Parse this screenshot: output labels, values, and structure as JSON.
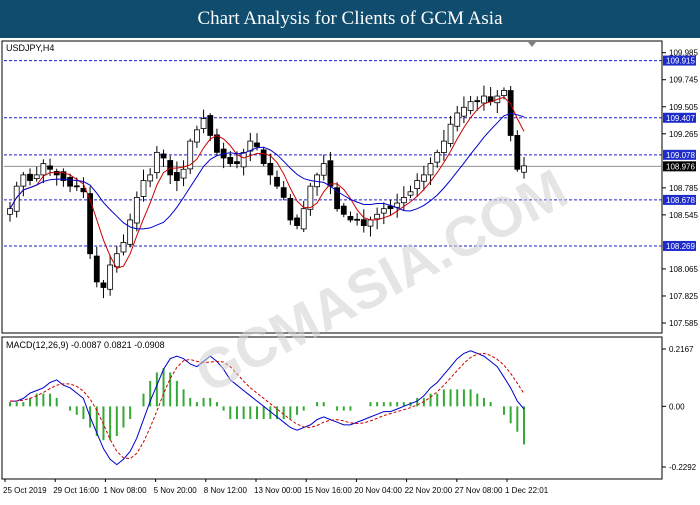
{
  "banner": {
    "title": "Chart Analysis for Clients of GCM Asia"
  },
  "watermark": "GCMASIA.COM",
  "chart_data": [
    {
      "type": "candlestick",
      "title": "USDJPY,H4",
      "ylim": [
        107.585,
        110.0
      ],
      "y_ticks": [
        "109.985",
        "109.745",
        "109.505",
        "109.265",
        "108.785",
        "108.545",
        "108.065",
        "107.825",
        "107.585"
      ],
      "levels": [
        {
          "label": "109.915",
          "value": 109.915
        },
        {
          "label": "109.407",
          "value": 109.407
        },
        {
          "label": "109.078",
          "value": 109.078
        },
        {
          "label": "108.678",
          "value": 108.678
        },
        {
          "label": "108.269",
          "value": 108.269
        }
      ],
      "current_price": {
        "label": "108.976",
        "value": 108.976
      },
      "close_path": [
        108.6,
        108.8,
        108.9,
        108.85,
        108.9,
        109.0,
        108.95,
        108.9,
        108.85,
        108.8,
        108.8,
        108.75,
        108.2,
        107.95,
        107.9,
        108.1,
        108.2,
        108.3,
        108.5,
        108.7,
        108.85,
        108.9,
        109.1,
        109.05,
        108.9,
        108.85,
        108.95,
        109.2,
        109.3,
        109.4,
        109.25,
        109.1,
        109.05,
        109.0,
        109.0,
        109.1,
        109.2,
        109.15,
        109.0,
        108.9,
        108.8,
        108.7,
        108.5,
        108.45,
        108.6,
        108.8,
        108.9,
        109.0,
        108.8,
        108.6,
        108.55,
        108.5,
        108.5,
        108.45,
        108.5,
        108.55,
        108.6,
        108.6,
        108.65,
        108.7,
        108.75,
        108.85,
        108.9,
        109.0,
        109.1,
        109.2,
        109.35,
        109.45,
        109.5,
        109.55,
        109.55,
        109.6,
        109.55,
        109.6,
        109.65,
        109.25,
        108.95,
        108.98
      ],
      "x_labels": [
        "25 Oct 2019",
        "29 Oct 16:00",
        "1 Nov 08:00",
        "5 Nov 20:00",
        "8 Nov 12:00",
        "13 Nov 00:00",
        "15 Nov 16:00",
        "20 Nov 04:00",
        "22 Nov 20:00",
        "27 Nov 08:00",
        "1 Dec 22:01"
      ],
      "series": [
        {
          "color": "#cc0000"
        },
        {
          "color": "#0000cc"
        }
      ]
    },
    {
      "type": "macd",
      "title": "MACD(12,26,9) -0.0087 0.0821 -0.0908",
      "ylim": [
        -0.2292,
        0.2167
      ],
      "y_ticks": [
        "0.2167",
        "0.00",
        "-0.2292"
      ],
      "macd_path": [
        0.02,
        0.02,
        0.03,
        0.05,
        0.06,
        0.07,
        0.09,
        0.1,
        0.08,
        0.07,
        0.05,
        0.03,
        -0.04,
        -0.1,
        -0.16,
        -0.2,
        -0.22,
        -0.2,
        -0.17,
        -0.12,
        -0.05,
        0.02,
        0.08,
        0.14,
        0.18,
        0.19,
        0.18,
        0.16,
        0.15,
        0.17,
        0.19,
        0.17,
        0.14,
        0.1,
        0.08,
        0.06,
        0.04,
        0.02,
        0.0,
        -0.02,
        -0.04,
        -0.06,
        -0.08,
        -0.09,
        -0.08,
        -0.07,
        -0.05,
        -0.04,
        -0.05,
        -0.06,
        -0.07,
        -0.07,
        -0.06,
        -0.05,
        -0.04,
        -0.03,
        -0.02,
        -0.02,
        -0.01,
        0.0,
        0.01,
        0.02,
        0.04,
        0.07,
        0.09,
        0.12,
        0.15,
        0.18,
        0.2,
        0.21,
        0.2,
        0.19,
        0.17,
        0.15,
        0.11,
        0.07,
        0.02,
        -0.01
      ],
      "histogram_path": [
        0.01,
        0.01,
        0.01,
        0.02,
        0.03,
        0.03,
        0.03,
        0.02,
        0.0,
        -0.01,
        -0.02,
        -0.03,
        -0.05,
        -0.07,
        -0.08,
        -0.08,
        -0.07,
        -0.05,
        -0.03,
        0.0,
        0.03,
        0.06,
        0.08,
        0.09,
        0.08,
        0.06,
        0.04,
        0.02,
        0.01,
        0.02,
        0.02,
        0.01,
        -0.01,
        -0.03,
        -0.03,
        -0.03,
        -0.03,
        -0.03,
        -0.03,
        -0.03,
        -0.03,
        -0.03,
        -0.03,
        -0.02,
        -0.01,
        0.0,
        0.01,
        0.01,
        0.0,
        -0.01,
        -0.01,
        -0.01,
        0.0,
        0.0,
        0.01,
        0.01,
        0.01,
        0.01,
        0.01,
        0.01,
        0.01,
        0.02,
        0.02,
        0.03,
        0.03,
        0.04,
        0.04,
        0.04,
        0.04,
        0.04,
        0.03,
        0.02,
        0.01,
        0.0,
        -0.02,
        -0.04,
        -0.06,
        -0.09
      ],
      "series": [
        {
          "color": "#0000cc"
        },
        {
          "color": "#cc0000"
        },
        {
          "color": "#33aa33"
        }
      ]
    }
  ]
}
